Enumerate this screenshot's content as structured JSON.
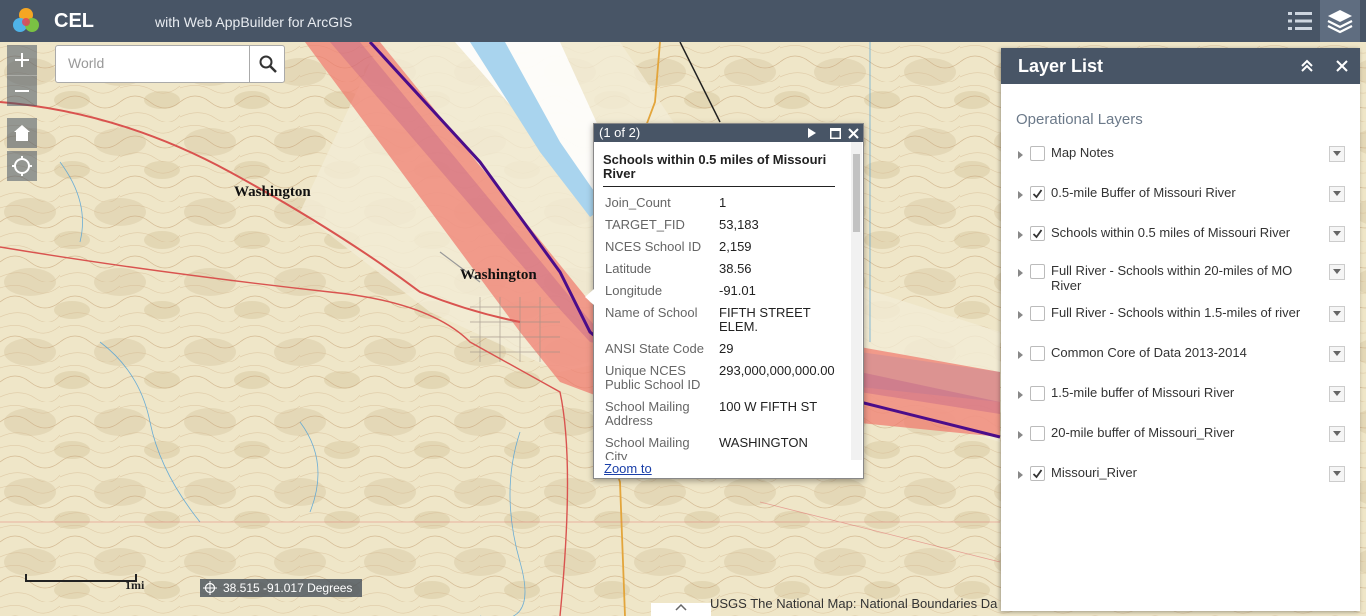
{
  "header": {
    "title": "CEL",
    "subtitle": "with Web AppBuilder for ArcGIS"
  },
  "icons": {
    "logo": "arcgis-cube-logo",
    "list": "list-icon",
    "layers": "layers-icon",
    "zoom_in": "plus-icon",
    "zoom_out": "minus-icon",
    "home": "home-icon",
    "locate": "locate-icon",
    "search": "search-icon"
  },
  "search": {
    "placeholder": "World"
  },
  "map": {
    "labels": [
      "Washington",
      "Washington"
    ]
  },
  "popup": {
    "counter": "(1 of 2)",
    "heading": "Schools within 0.5 miles of Missouri River",
    "attributes": [
      {
        "key": "Join_Count",
        "value": "1"
      },
      {
        "key": "TARGET_FID",
        "value": "53,183"
      },
      {
        "key": "NCES School ID",
        "value": "2,159"
      },
      {
        "key": "Latitude",
        "value": "38.56"
      },
      {
        "key": "Longitude",
        "value": "-91.01"
      },
      {
        "key": "Name of School",
        "value": "FIFTH STREET ELEM."
      },
      {
        "key": "ANSI State Code",
        "value": "29"
      },
      {
        "key": "Unique NCES Public School ID",
        "value": "293,000,000,000.00"
      },
      {
        "key": "School Mailing Address",
        "value": "100 W FIFTH ST"
      },
      {
        "key": "School Mailing City",
        "value": "WASHINGTON"
      }
    ],
    "zoom_link": "Zoom to"
  },
  "layer_list": {
    "title": "Layer List",
    "section": "Operational Layers",
    "layers": [
      {
        "name": "Map Notes",
        "checked": false
      },
      {
        "name": "0.5-mile Buffer of Missouri River",
        "checked": true
      },
      {
        "name": "Schools within 0.5 miles of Missouri River",
        "checked": true
      },
      {
        "name": "Full River - Schools within 20-miles of MO River",
        "checked": false
      },
      {
        "name": "Full River - Schools within 1.5-miles of river",
        "checked": false
      },
      {
        "name": "Common Core of Data 2013-2014",
        "checked": false
      },
      {
        "name": "1.5-mile buffer of Missouri River",
        "checked": false
      },
      {
        "name": "20-mile buffer of Missouri_River",
        "checked": false
      },
      {
        "name": "Missouri_River",
        "checked": true
      }
    ]
  },
  "scalebar": {
    "label": "1mi"
  },
  "coordinates": "38.515 -91.017 Degrees",
  "attribution": "USGS The National Map: National Boundaries Da",
  "colors": {
    "header": "#485566",
    "buffer": "#f07a6e",
    "river_line": "#4b0d8a",
    "popup_link": "#1a3fa8"
  }
}
